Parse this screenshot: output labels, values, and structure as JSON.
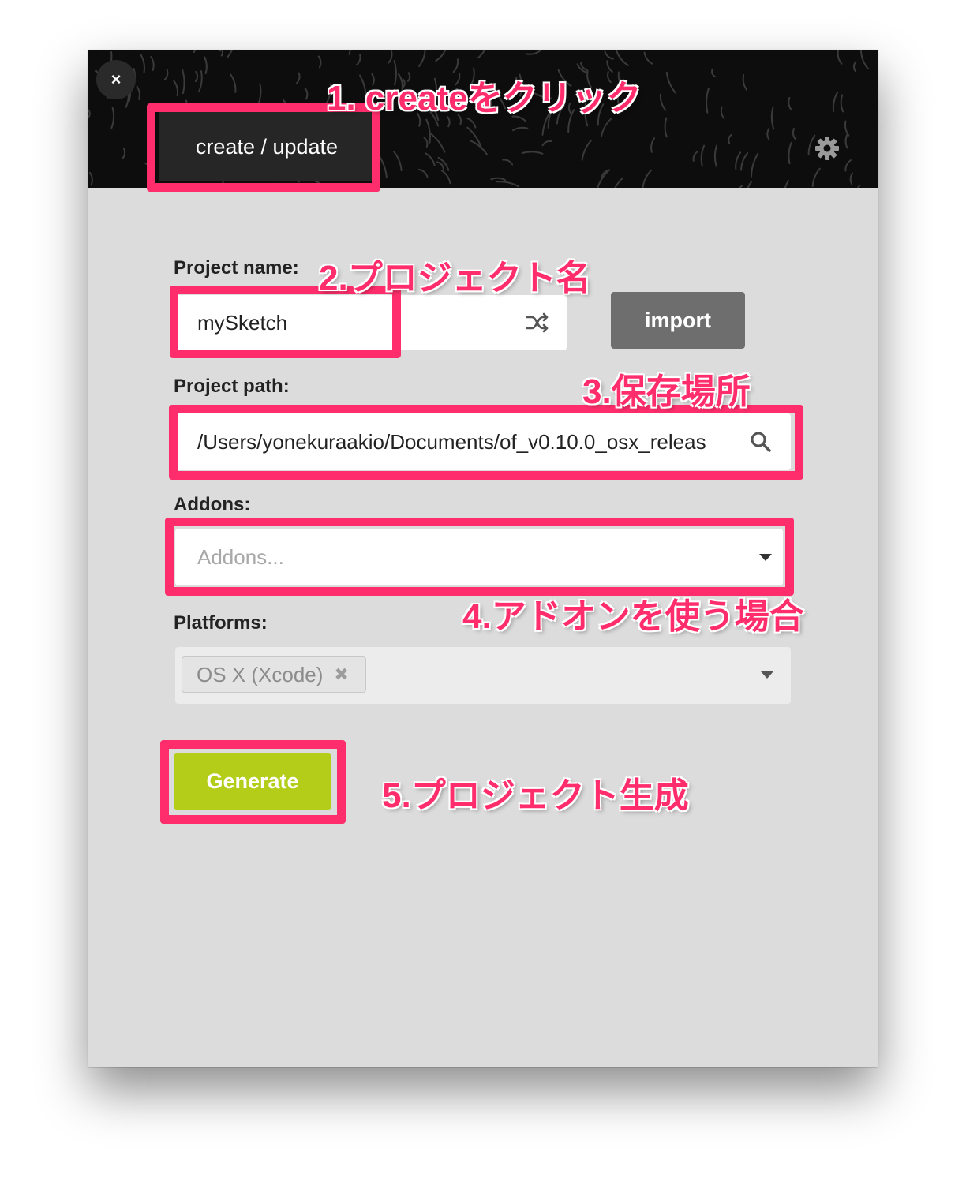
{
  "titlebar": {
    "close_glyph": "×",
    "tab_label": "create / update",
    "settings_icon": "gear-icon"
  },
  "form": {
    "project_name_label": "Project name:",
    "project_name_value": "mySketch",
    "shuffle_icon": "shuffle-icon",
    "import_label": "import",
    "project_path_label": "Project path:",
    "project_path_value": "/Users/yonekuraakio/Documents/of_v0.10.0_osx_releas",
    "search_icon": "search-icon",
    "addons_label": "Addons:",
    "addons_placeholder": "Addons...",
    "platforms_label": "Platforms:",
    "platform_chip": "OS X (Xcode)",
    "platform_chip_remove": "✖",
    "generate_label": "Generate"
  },
  "annotations": {
    "step1": "1. createをクリック",
    "step2": "2.プロジェクト名",
    "step3": "3.保存場所",
    "step4": "4.アドオンを使う場合",
    "step5": "5.プロジェクト生成"
  },
  "colors": {
    "highlight": "#ff2d6b",
    "generate": "#b3cd19",
    "import": "#6e6e6e",
    "titlebar": "#0d0d0d",
    "panel": "#dcdcdc"
  }
}
